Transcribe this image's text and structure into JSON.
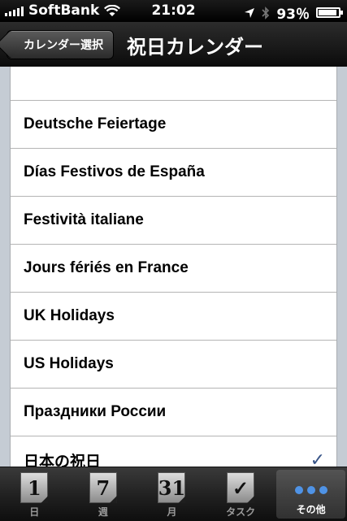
{
  "status": {
    "carrier": "SoftBank",
    "time": "21:02",
    "battery": "93％",
    "battery_level": 0.93
  },
  "nav": {
    "back_label": "カレンダー選択",
    "title": "祝日カレンダー"
  },
  "list": {
    "items": [
      {
        "label": "Deutsche Feiertage",
        "checked": false
      },
      {
        "label": "Días Festivos de España",
        "checked": false
      },
      {
        "label": "Festività italiane",
        "checked": false
      },
      {
        "label": "Jours fériés en France",
        "checked": false
      },
      {
        "label": "UK Holidays",
        "checked": false
      },
      {
        "label": "US Holidays",
        "checked": false
      },
      {
        "label": "Праздники России",
        "checked": false
      },
      {
        "label": "日本の祝日",
        "checked": true
      }
    ],
    "check_glyph": "✓"
  },
  "tabs": [
    {
      "icon_text": "1",
      "label": "日",
      "icon": "day-calendar-icon"
    },
    {
      "icon_text": "7",
      "label": "週",
      "icon": "week-calendar-icon"
    },
    {
      "icon_text": "31",
      "label": "月",
      "icon": "month-calendar-icon"
    },
    {
      "icon_text": "✓",
      "label": "タスク",
      "icon": "task-check-icon"
    },
    {
      "icon_text": "",
      "label": "その他",
      "icon": "more-dots-icon",
      "active": true
    }
  ],
  "colors": {
    "check": "#385487",
    "more_dots": "#4f93e6"
  }
}
